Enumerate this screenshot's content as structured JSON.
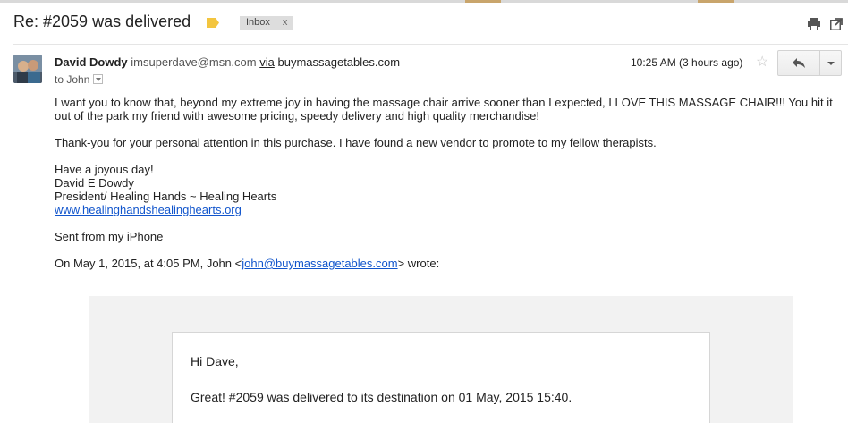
{
  "email": {
    "subject": "Re: #2059 was delivered",
    "label_chip": "Inbox",
    "label_chip_close": "x",
    "sender": {
      "name": "David Dowdy",
      "email": "imsuperdave@msn.com",
      "via_label": "via",
      "via_domain": "buymassagetables.com",
      "to_line": "to John"
    },
    "time": "10:25 AM (3 hours ago)",
    "body": {
      "p1_line1": "I want you to know that, beyond my extreme joy in having the massage chair arrive sooner than I expected, I LOVE THIS MASSAGE CHAIR!!!  You hit it",
      "p1_line2": "out of the park my friend with awesome pricing, speedy delivery and high quality merchandise!",
      "p2": "Thank-you for your personal attention in this purchase.  I have found a new vendor to promote to my fellow therapists.",
      "sig_line1": "Have a joyous day!",
      "sig_line2": "David E Dowdy",
      "sig_line3": "President/ Healing Hands ~ Healing Hearts",
      "sig_link": "www.healinghandshealinghearts.org",
      "sent_from": "Sent from my iPhone",
      "quote_prefix": "On May 1, 2015, at 4:05 PM, John <",
      "quote_email": "john@buymassagetables.com",
      "quote_suffix": "> wrote:"
    },
    "quoted": {
      "greeting": "Hi Dave,",
      "message": "Great! #2059 was delivered to its destination on 01 May, 2015 15:40."
    }
  },
  "icons": {
    "label": "label-tag-icon",
    "print": "print-icon",
    "new_window": "new-window-icon",
    "star": "star-icon",
    "reply": "reply-icon",
    "more": "chevron-down-icon"
  },
  "colors": {
    "link": "#1155cc",
    "label_tag": "#f3c53f",
    "chip_bg": "#dddddd",
    "quote_bg": "#f2f2f2"
  }
}
